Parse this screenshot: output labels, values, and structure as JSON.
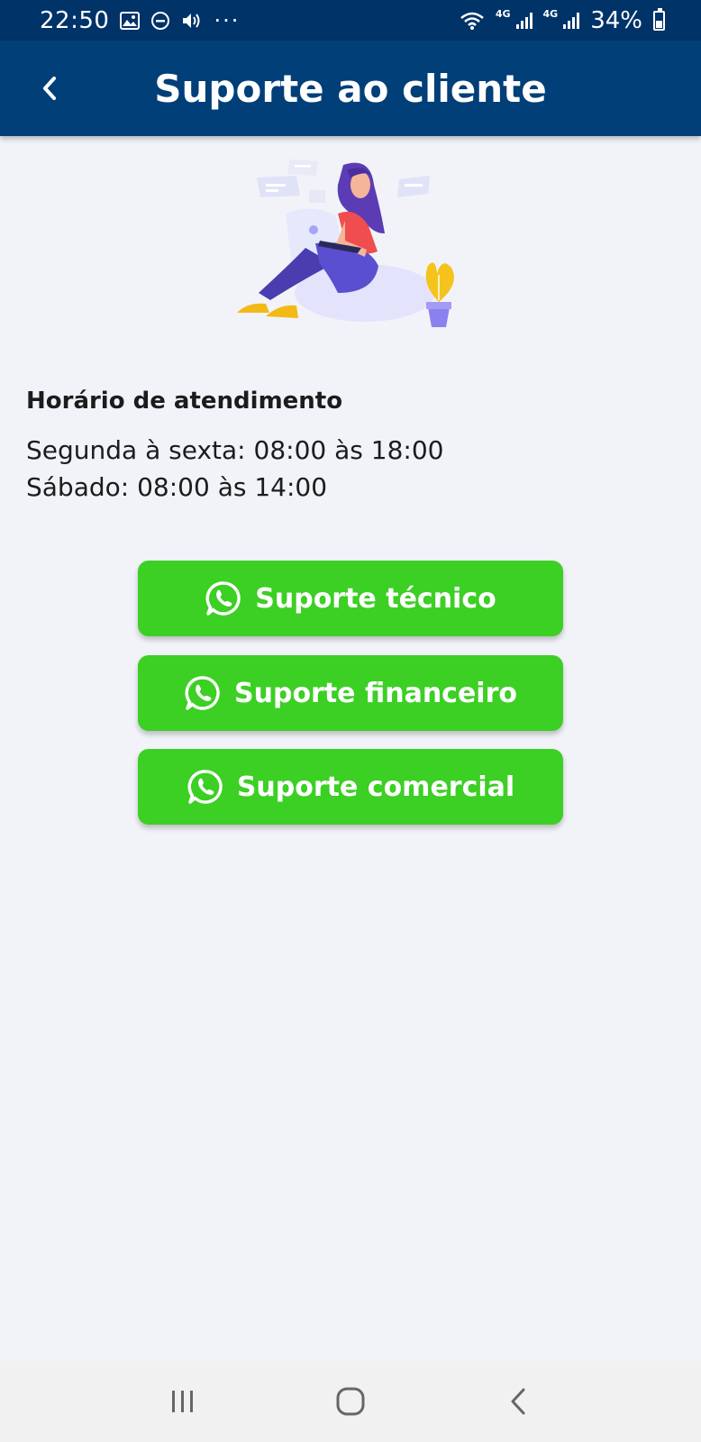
{
  "status_bar": {
    "time": "22:50",
    "dots": "···",
    "network_small_1": "4G",
    "network_small_2": "4G",
    "battery": "34%",
    "icons": [
      "image-icon",
      "do-not-disturb-icon",
      "volume-icon",
      "wifi-icon",
      "signal-icon",
      "battery-icon"
    ]
  },
  "header": {
    "title": "Suporte ao cliente",
    "back_icon": "chevron-left-icon"
  },
  "illustration": {
    "icon": "customer-support-illustration"
  },
  "hours": {
    "heading": "Horário de atendimento",
    "weekdays": "Segunda à sexta: 08:00 às 18:00",
    "saturday": "Sábado: 08:00 às 14:00"
  },
  "buttons": [
    {
      "label": "Suporte técnico",
      "icon": "whatsapp-icon"
    },
    {
      "label": "Suporte financeiro",
      "icon": "whatsapp-icon"
    },
    {
      "label": "Suporte comercial",
      "icon": "whatsapp-icon"
    }
  ],
  "nav_bar": {
    "items": [
      "recent-apps-icon",
      "home-icon",
      "back-icon"
    ]
  },
  "colors": {
    "status_bar": "#003368",
    "app_bar": "#003f78",
    "button_green": "#3ccf24",
    "background": "#f1f3f8"
  }
}
